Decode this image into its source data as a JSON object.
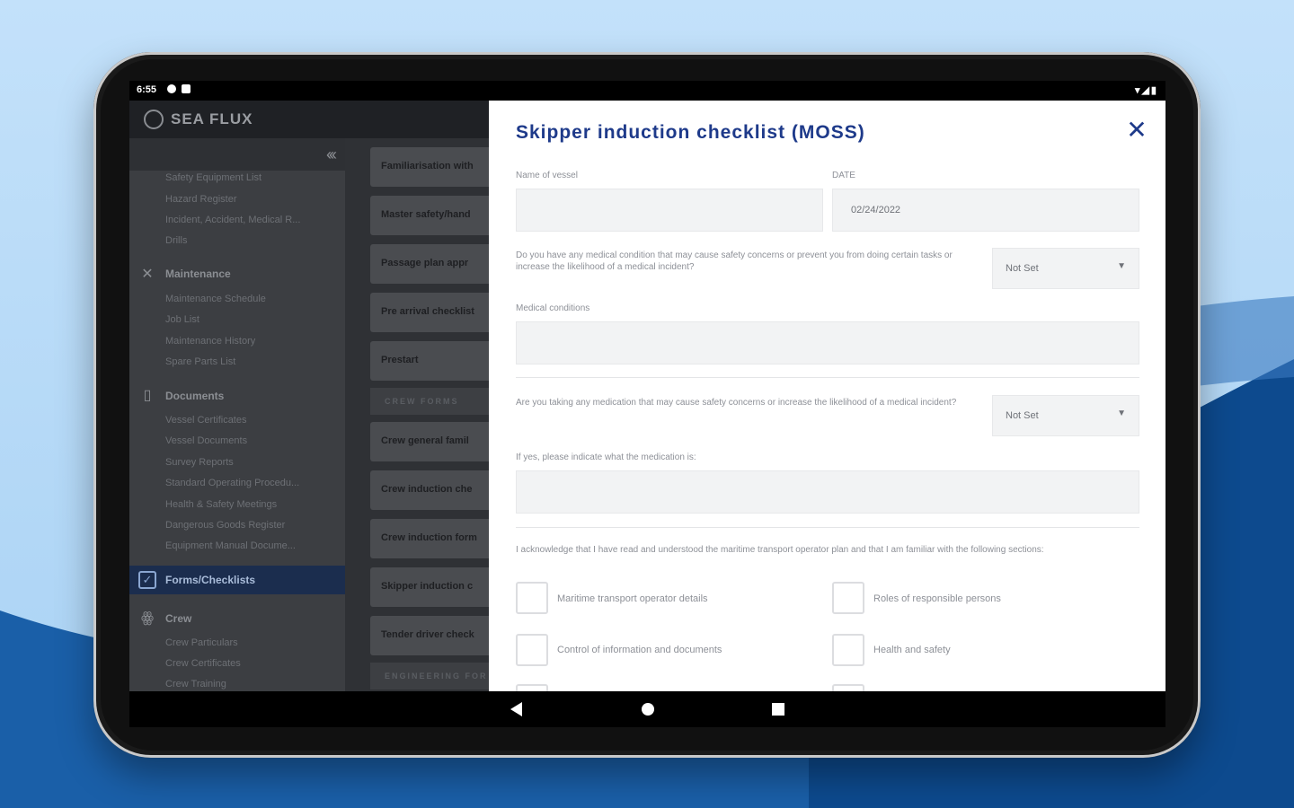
{
  "status_bar": {
    "time": "6:55"
  },
  "app": {
    "logo_text": "SEA FLUX"
  },
  "sidebar": {
    "collapse_label": "«‹",
    "items_top": [
      "Safety Equipment List",
      "Hazard Register",
      "Incident, Accident, Medical R...",
      "Drills"
    ],
    "sections": [
      {
        "label": "Maintenance",
        "items": [
          "Maintenance Schedule",
          "Job List",
          "Maintenance History",
          "Spare Parts List"
        ]
      },
      {
        "label": "Documents",
        "items": [
          "Vessel Certificates",
          "Vessel Documents",
          "Survey Reports",
          "Standard Operating Procedu...",
          "Health & Safety Meetings",
          "Dangerous Goods Register",
          "Equipment Manual Docume..."
        ]
      },
      {
        "label": "Forms/Checklists",
        "items": []
      },
      {
        "label": "Crew",
        "items": [
          "Crew Particulars",
          "Crew Certificates",
          "Crew Training"
        ]
      }
    ]
  },
  "midlist": {
    "cards": [
      "Familiarisation with",
      "Master safety/hand",
      "Passage plan appr",
      "Pre arrival checklist",
      "Prestart"
    ],
    "crew_header": "CREW FORMS",
    "crew_cards": [
      "Crew general famil",
      "Crew induction che",
      "Crew induction form",
      "Skipper induction c",
      "Tender driver check"
    ],
    "engineering_header": "ENGINEERING FOR"
  },
  "modal": {
    "title": "Skipper induction checklist (MOSS)",
    "close_label": "✕",
    "vessel_label": "Name of vessel",
    "vessel_value": "",
    "date_label": "DATE",
    "date_value": "02/24/2022",
    "q1": "Do you have any medical condition that may cause safety concerns or prevent you from doing certain tasks or increase the likelihood of a medical incident?",
    "q1_select": "Not Set",
    "medical_label": "Medical conditions",
    "medical_value": "",
    "q2": "Are you taking any medication that may cause safety concerns or increase the likelihood of a medical incident?",
    "q2_select": "Not Set",
    "medication_label": "If yes, please indicate what the medication is:",
    "medication_value": "",
    "acknowledge": "I acknowledge that I have read and understood the maritime transport operator plan and that I am familiar with the following sections:",
    "checkboxes": [
      "Maritime transport operator details",
      "Roles of responsible persons",
      "Control of information and documents",
      "Health and safety"
    ]
  }
}
